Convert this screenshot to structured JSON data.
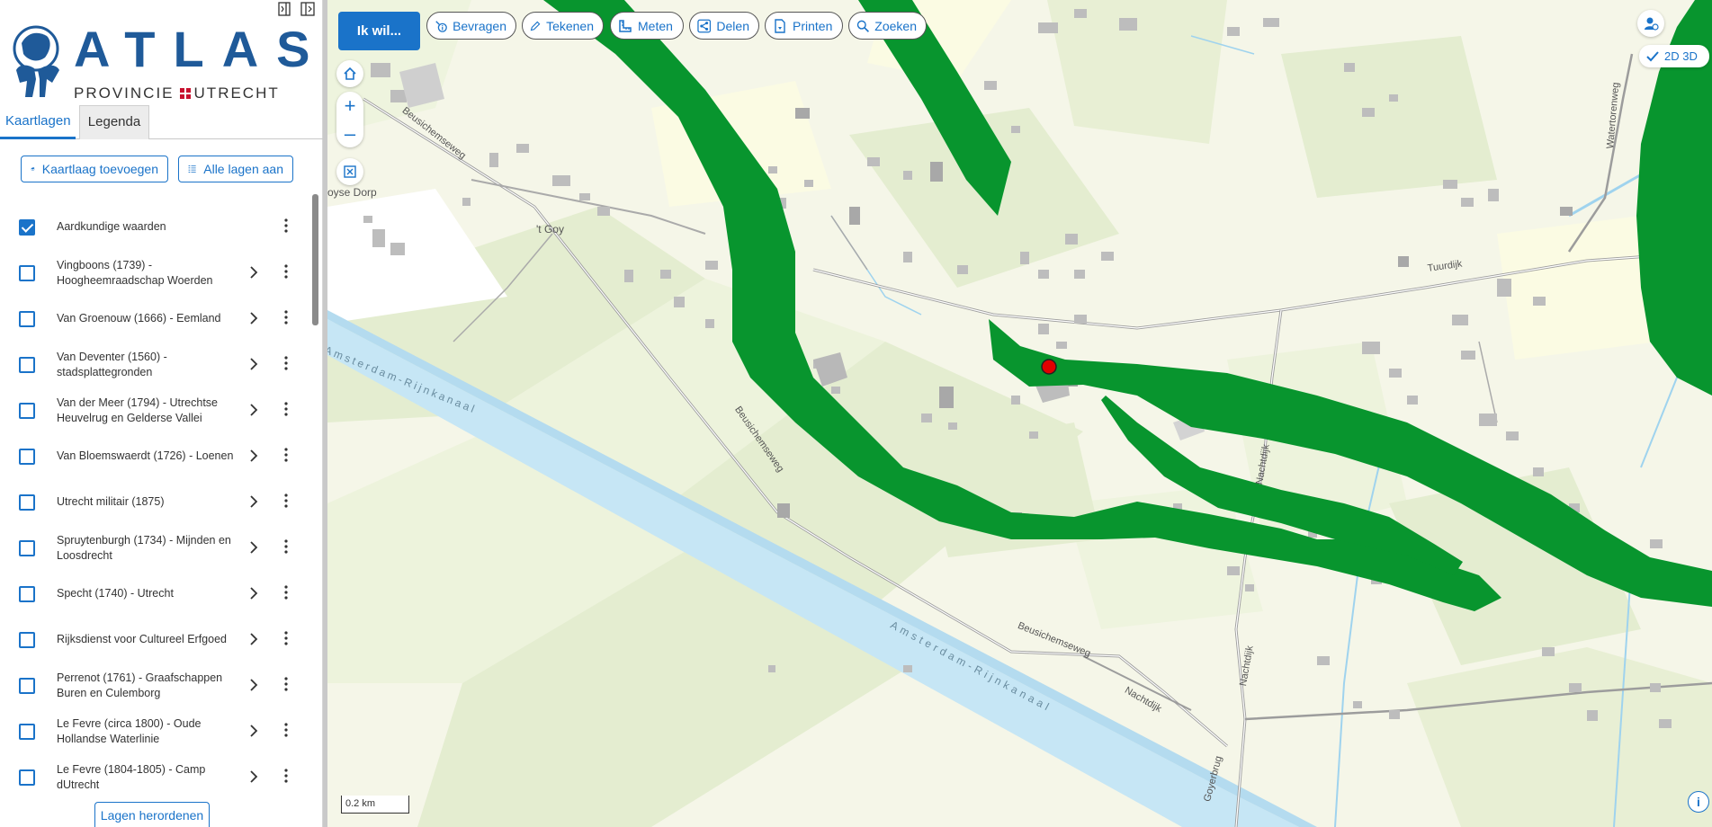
{
  "brand": {
    "name": "ATLAS",
    "subtitle_left": "PROVINCIE",
    "subtitle_right": "UTRECHT"
  },
  "tabs": [
    {
      "label": "Kaartlagen",
      "active": true
    },
    {
      "label": "Legenda",
      "active": false
    }
  ],
  "sidebar": {
    "add_layer_label": "Kaartlaag toevoegen",
    "all_layers_label": "Alle lagen aan",
    "reorder_label": "Lagen herordenen",
    "layers": [
      {
        "label": "Aardkundige waarden",
        "checked": true,
        "has_chevron": false
      },
      {
        "label": "Vingboons (1739) - Hoogheemraadschap Woerden",
        "checked": false,
        "has_chevron": true
      },
      {
        "label": "Van Groenouw (1666) - Eemland",
        "checked": false,
        "has_chevron": true
      },
      {
        "label": "Van Deventer (1560) - stadsplattegronden",
        "checked": false,
        "has_chevron": true
      },
      {
        "label": "Van der Meer (1794) - Utrechtse Heuvelrug en Gelderse Vallei",
        "checked": false,
        "has_chevron": true
      },
      {
        "label": "Van Bloemswaerdt (1726) - Loenen",
        "checked": false,
        "has_chevron": true
      },
      {
        "label": "Utrecht militair (1875)",
        "checked": false,
        "has_chevron": true
      },
      {
        "label": "Spruytenburgh (1734) - Mijnden en Loosdrecht",
        "checked": false,
        "has_chevron": true
      },
      {
        "label": "Specht (1740) - Utrecht",
        "checked": false,
        "has_chevron": true
      },
      {
        "label": "Rijksdienst voor Cultureel Erfgoed",
        "checked": false,
        "has_chevron": true
      },
      {
        "label": "Perrenot (1761) - Graafschappen Buren en Culemborg",
        "checked": false,
        "has_chevron": true
      },
      {
        "label": "Le Fevre (circa 1800) - Oude Hollandse Waterlinie",
        "checked": false,
        "has_chevron": true
      },
      {
        "label": "Le Fevre (1804-1805) - Camp dUtrecht",
        "checked": false,
        "has_chevron": true
      }
    ]
  },
  "toolbar": {
    "primary_label": "Ik wil...",
    "buttons": [
      {
        "label": "Bevragen",
        "icon": "info-query-icon"
      },
      {
        "label": "Tekenen",
        "icon": "pencil-icon"
      },
      {
        "label": "Meten",
        "icon": "ruler-icon"
      },
      {
        "label": "Delen",
        "icon": "share-icon"
      },
      {
        "label": "Printen",
        "icon": "print-icon"
      },
      {
        "label": "Zoeken",
        "icon": "search-icon"
      }
    ]
  },
  "map_controls": {
    "dimension_toggle": "2D 3D",
    "scale_label": "0.2 km"
  },
  "map_labels": {
    "goy": "'t Goy",
    "goyse_dorp": "oyse Dorp",
    "beusichemseweg": "Beusichemseweg",
    "beusichemseweg_2": "Beusichemseweg",
    "beusichemseweg_3": "Beusichemseweg",
    "canal": "Amsterdam-Rijnkanaal",
    "canal_2": "Amsterdam-Rijnkanaal",
    "tuurdijk": "Tuurdijk",
    "watertorenweg": "Watertorenweg",
    "nachtdijk": "Nachtdijk",
    "nachtdijk_2": "Nachtdijk",
    "nachtdijk_3": "Nachtdijk",
    "goyerbrug": "Goyerbrug"
  },
  "colors": {
    "accent": "#1a73c9",
    "layer_green": "#08952e",
    "canal": "#c6e6f5",
    "marker": "#e00000"
  }
}
